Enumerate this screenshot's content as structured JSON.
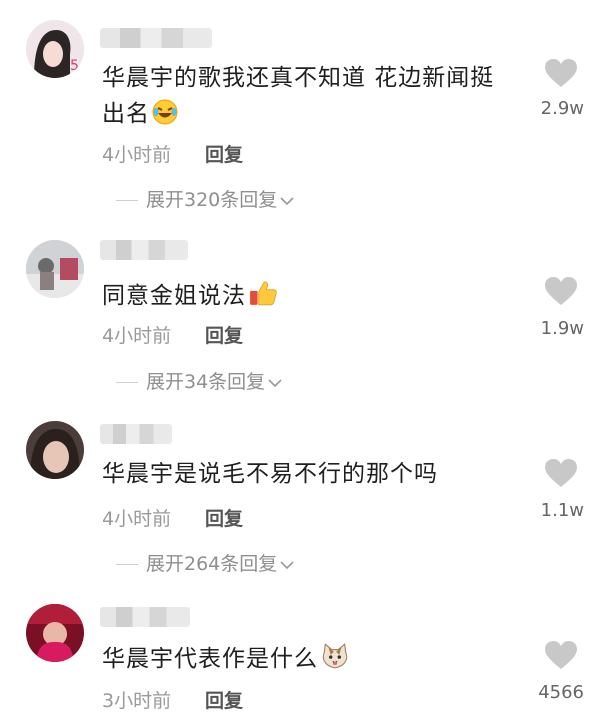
{
  "comments": [
    {
      "text_line1": "华晨宇的歌我还真不知道 花边新闻挺",
      "text_line2": "出名",
      "emoji": "laughing-tears-emoji",
      "time": "4小时前",
      "reply_label": "回复",
      "expand_label": "展开320条回复",
      "like_count": "2.9w"
    },
    {
      "text_line1": "同意金姐说法",
      "emoji": "thumbs-up-emoji",
      "time": "4小时前",
      "reply_label": "回复",
      "expand_label": "展开34条回复",
      "like_count": "1.9w"
    },
    {
      "text_line1": "华晨宇是说毛不易不行的那个吗",
      "time": "4小时前",
      "reply_label": "回复",
      "expand_label": "展开264条回复",
      "like_count": "1.1w"
    },
    {
      "text_line1": "华晨宇代表作是什么",
      "emoji": "cat-face-emoji",
      "time": "3小时前",
      "reply_label": "回复",
      "like_count": "4566"
    }
  ],
  "colors": {
    "text": "#1f1f1f",
    "meta": "#9a9a9a",
    "heart": "#c8c8c8"
  },
  "icons": [
    "heart-icon",
    "chevron-down-icon"
  ]
}
